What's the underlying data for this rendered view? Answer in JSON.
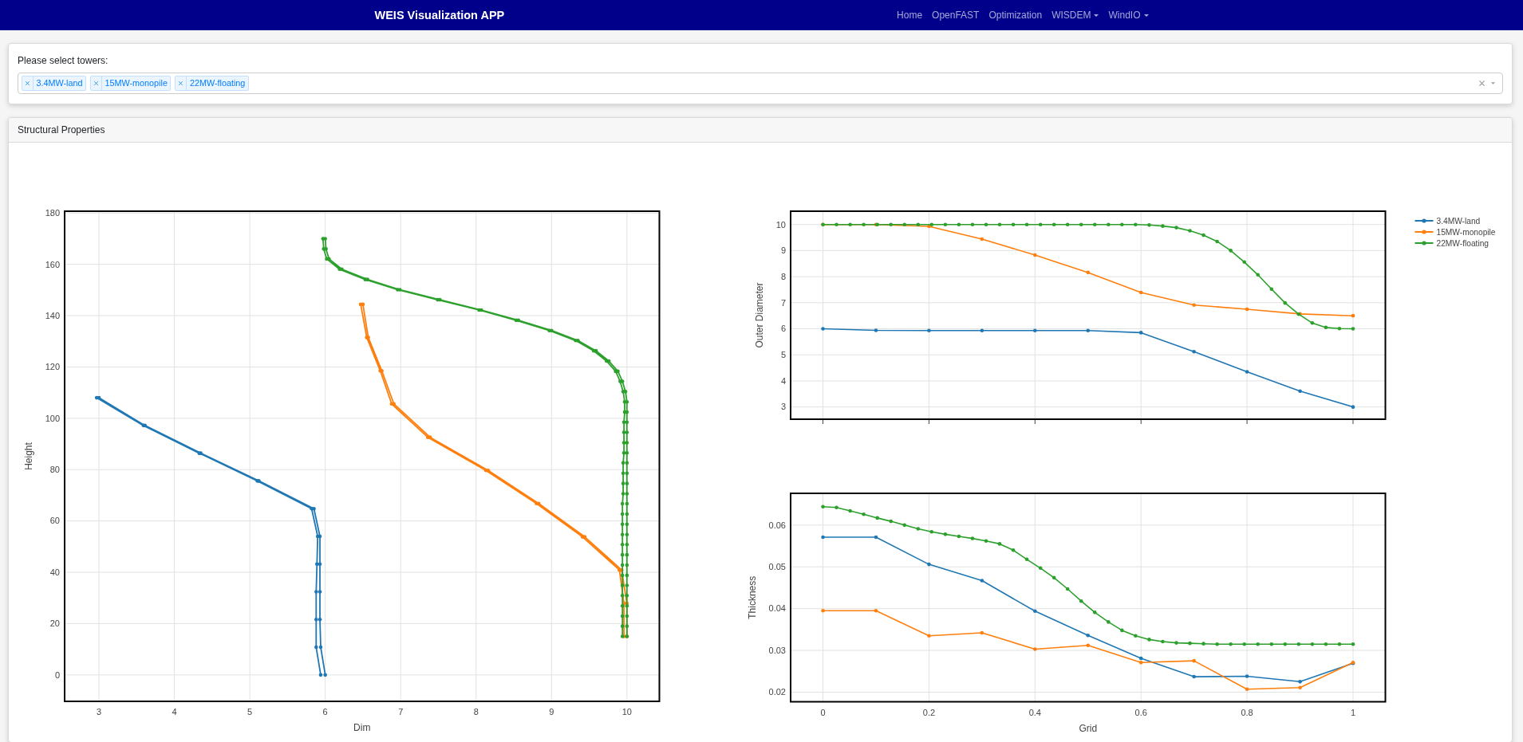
{
  "navbar": {
    "brand": "WEIS Visualization APP",
    "links": [
      {
        "label": "Home",
        "dropdown": false
      },
      {
        "label": "OpenFAST",
        "dropdown": false
      },
      {
        "label": "Optimization",
        "dropdown": false
      },
      {
        "label": "WISDEM",
        "dropdown": true
      },
      {
        "label": "WindIO",
        "dropdown": true
      }
    ]
  },
  "tower_select": {
    "label": "Please select towers:",
    "tags": [
      "3.4MW-land",
      "15MW-monopile",
      "22MW-floating"
    ]
  },
  "structural_properties": {
    "title": "Structural Properties",
    "height_chart": {
      "chart_data": {
        "type": "line",
        "xlabel": "Dim",
        "ylabel": "Height",
        "grid": true,
        "xlim": [
          2.545,
          10.43
        ],
        "ylim": [
          -10.3,
          180.7
        ],
        "xticks": [
          3,
          4,
          5,
          6,
          7,
          8,
          9,
          10
        ],
        "yticks": [
          0,
          20,
          40,
          60,
          80,
          100,
          120,
          140,
          160,
          180
        ],
        "series": [
          {
            "color": "#1f77b4",
            "x": [
              6,
              5.94,
              5.93,
              5.93,
              5.93,
              5.93,
              5.85,
              5.12,
              4.35,
              3.61,
              3,
              2.97,
              3.59,
              4.33,
              5.1,
              5.82,
              5.9,
              5.89,
              5.88,
              5.88,
              5.88,
              5.94
            ],
            "values": [
              0,
              10.8,
              21.6,
              32.4,
              43.2,
              54,
              64.8,
              75.6,
              86.4,
              97.2,
              108,
              108,
              97.2,
              86.4,
              75.6,
              64.8,
              54,
              43.2,
              32.4,
              21.6,
              10.8,
              0
            ]
          },
          {
            "color": "#ff7f0e",
            "x": [
              10,
              10,
              9.93,
              9.44,
              8.83,
              8.16,
              7.39,
              6.91,
              6.75,
              6.57,
              6.5,
              6.47,
              6.55,
              6.73,
              6.88,
              7.36,
              8.13,
              8.8,
              9.41,
              9.9,
              9.96,
              9.96
            ],
            "values": [
              15,
              27.9,
              40.9,
              53.8,
              66.8,
              79.7,
              92.6,
              105.6,
              118.5,
              131.5,
              144.4,
              144.4,
              131.5,
              118.5,
              105.6,
              92.6,
              79.7,
              66.8,
              53.8,
              40.9,
              27.9,
              15
            ]
          },
          {
            "color": "#2ca02c",
            "x": [
              10,
              10,
              10,
              10,
              10,
              10,
              10,
              10,
              10,
              10,
              10,
              10,
              10,
              10,
              10,
              10,
              10,
              10,
              10,
              10,
              10,
              10,
              10,
              10,
              9.98,
              9.94,
              9.88,
              9.76,
              9.59,
              9.35,
              9,
              8.56,
              8.07,
              7.52,
              6.99,
              6.56,
              6.22,
              6.05,
              6.01,
              6,
              5.97,
              5.98,
              6.02,
              6.19,
              6.53,
              6.96,
              7.49,
              8.04,
              8.53,
              8.97,
              9.32,
              9.56,
              9.73,
              9.85,
              9.91,
              9.95,
              9.97,
              9.97,
              9.96,
              9.96,
              9.96,
              9.96,
              9.95,
              9.95,
              9.95,
              9.95,
              9.94,
              9.94,
              9.94,
              9.94,
              9.94,
              9.94,
              9.94,
              9.94,
              9.94,
              9.94,
              9.94,
              9.94,
              9.94,
              9.94
            ],
            "values": [
              15,
              19,
              22.9,
              26.9,
              30.9,
              34.9,
              38.8,
              42.8,
              46.8,
              50.8,
              54.7,
              58.7,
              62.7,
              66.7,
              70.6,
              74.6,
              78.6,
              82.6,
              86.5,
              90.5,
              94.5,
              98.5,
              102.4,
              106.4,
              110.4,
              114.4,
              118.3,
              122.3,
              126.3,
              130.3,
              134.2,
              138.2,
              142.2,
              146.2,
              150.1,
              154.1,
              158.1,
              162.1,
              166,
              170,
              170,
              166,
              162.1,
              158.1,
              154.1,
              150.1,
              146.2,
              142.2,
              138.2,
              134.2,
              130.3,
              126.3,
              122.3,
              118.3,
              114.4,
              110.4,
              106.4,
              102.4,
              98.5,
              94.5,
              90.5,
              86.5,
              82.6,
              78.6,
              74.6,
              70.6,
              66.7,
              62.7,
              58.7,
              54.7,
              50.8,
              46.8,
              42.8,
              38.8,
              34.9,
              30.9,
              26.9,
              22.9,
              19,
              15
            ]
          }
        ]
      }
    },
    "outer_diameter_chart": {
      "chart_data": {
        "type": "line",
        "ylabel": "Outer Diameter",
        "grid": true,
        "legend": "right",
        "xlim": [
          -0.061,
          1.061
        ],
        "ylim": [
          2.53,
          10.51
        ],
        "yticks": [
          3,
          4,
          5,
          6,
          7,
          8,
          9,
          10
        ],
        "series": [
          {
            "name": "3.4MW-land",
            "color": "#1f77b4",
            "x": [
              0,
              0.1,
              0.2,
              0.3,
              0.4,
              0.5,
              0.6,
              0.7,
              0.8,
              0.9,
              1
            ],
            "values": [
              6,
              5.94,
              5.93,
              5.93,
              5.93,
              5.93,
              5.85,
              5.12,
              4.35,
              3.61,
              3
            ]
          },
          {
            "name": "15MW-monopile",
            "color": "#ff7f0e",
            "x": [
              0,
              0.1,
              0.2,
              0.3,
              0.4,
              0.5,
              0.6,
              0.7,
              0.8,
              0.9,
              1
            ],
            "values": [
              10,
              10,
              9.93,
              9.44,
              8.83,
              8.16,
              7.39,
              6.91,
              6.75,
              6.57,
              6.5
            ]
          },
          {
            "name": "22MW-floating",
            "color": "#2ca02c",
            "x": [
              0,
              0.0256,
              0.0513,
              0.0769,
              0.1026,
              0.1282,
              0.1538,
              0.1795,
              0.2051,
              0.2308,
              0.2564,
              0.2821,
              0.3077,
              0.3333,
              0.359,
              0.3846,
              0.4103,
              0.4359,
              0.4615,
              0.4872,
              0.5128,
              0.5385,
              0.5641,
              0.5897,
              0.6154,
              0.641,
              0.6667,
              0.6923,
              0.7179,
              0.7436,
              0.7692,
              0.7949,
              0.8205,
              0.8462,
              0.8718,
              0.8974,
              0.9231,
              0.9487,
              0.9744,
              1
            ],
            "values": [
              10,
              10,
              10,
              10,
              10,
              10,
              10,
              10,
              10,
              10,
              10,
              10,
              10,
              10,
              10,
              10,
              10,
              10,
              10,
              10,
              10,
              10,
              10,
              10,
              9.98,
              9.94,
              9.88,
              9.76,
              9.59,
              9.35,
              9,
              8.56,
              8.07,
              7.52,
              6.99,
              6.56,
              6.22,
              6.05,
              6.01,
              6
            ]
          }
        ]
      }
    },
    "thickness_chart": {
      "chart_data": {
        "type": "line",
        "xlabel": "Grid",
        "ylabel": "Thickness",
        "grid": true,
        "xlim": [
          -0.061,
          1.061
        ],
        "ylim": [
          0.0177,
          0.0676
        ],
        "xticks": [
          0,
          0.2,
          0.4,
          0.6,
          0.8,
          1
        ],
        "yticks": [
          0.02,
          0.03,
          0.04,
          0.05,
          0.06
        ],
        "series": [
          {
            "color": "#1f77b4",
            "x": [
              0,
              0.1,
              0.2,
              0.3,
              0.4,
              0.5,
              0.6,
              0.7,
              0.8,
              0.9,
              1
            ],
            "values": [
              0.0571,
              0.0571,
              0.0506,
              0.0467,
              0.0394,
              0.0336,
              0.0281,
              0.0237,
              0.0238,
              0.0225,
              0.0269
            ]
          },
          {
            "color": "#ff7f0e",
            "x": [
              0,
              0.1,
              0.2,
              0.3,
              0.4,
              0.5,
              0.6,
              0.7,
              0.8,
              0.9,
              1
            ],
            "values": [
              0.0395,
              0.0395,
              0.0335,
              0.0342,
              0.0303,
              0.0312,
              0.0271,
              0.0275,
              0.0207,
              0.0211,
              0.0271
            ]
          },
          {
            "color": "#2ca02c",
            "x": [
              0,
              0.0256,
              0.0513,
              0.0769,
              0.1026,
              0.1282,
              0.1538,
              0.1795,
              0.2051,
              0.2308,
              0.2564,
              0.2821,
              0.3077,
              0.3333,
              0.359,
              0.3846,
              0.4103,
              0.4359,
              0.4615,
              0.4872,
              0.5128,
              0.5385,
              0.5641,
              0.5897,
              0.6154,
              0.641,
              0.6667,
              0.6923,
              0.7179,
              0.7436,
              0.7692,
              0.7949,
              0.8205,
              0.8462,
              0.8718,
              0.8974,
              0.9231,
              0.9487,
              0.9744,
              1
            ],
            "values": [
              0.0644,
              0.0642,
              0.0634,
              0.0626,
              0.0617,
              0.0609,
              0.06,
              0.0591,
              0.0584,
              0.0578,
              0.0573,
              0.0568,
              0.0562,
              0.0555,
              0.054,
              0.0518,
              0.0497,
              0.0474,
              0.0447,
              0.0418,
              0.0391,
              0.0368,
              0.0348,
              0.0335,
              0.0326,
              0.0321,
              0.0318,
              0.0317,
              0.0316,
              0.0315,
              0.0315,
              0.0315,
              0.0315,
              0.0315,
              0.0315,
              0.0315,
              0.0315,
              0.0315,
              0.0315,
              0.0315
            ]
          }
        ]
      }
    }
  }
}
